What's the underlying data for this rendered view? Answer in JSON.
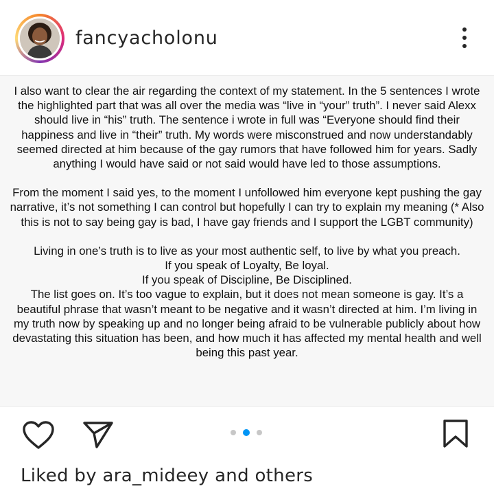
{
  "header": {
    "username": "fancyacholonu"
  },
  "post": {
    "paragraphs": [
      "I also want to clear the air regarding the context of my statement. In the 5 sentences I wrote the highlighted part that was all over the media was “live in “your” truth”. I never said Alexx should live in “his” truth. The sentence i wrote in full was “Everyone should find their happiness and live in “their” truth. My words were misconstrued and now understandably seemed directed at him because of the gay rumors that have followed him for years. Sadly anything I would have said or not said would have led to those assumptions.",
      "From the moment I said yes, to the moment I unfollowed him everyone kept pushing the gay narrative, it’s not something I can control but hopefully I can try to explain my meaning (* Also this is not to say being gay is bad, I have gay friends and I support the LGBT community)",
      "Living in one’s truth is to live as your most authentic self, to live by what you preach.",
      "If you speak of Loyalty, Be loyal.",
      "If you speak of Discipline, Be Disciplined.",
      "The list goes on. It’s too vague to explain, but it does not mean someone is gay. It’s a beautiful phrase that wasn’t meant to be negative and it wasn’t directed at him. I’m living in my truth now by speaking up and no longer being afraid to be vulnerable publicly about how devastating this situation has been, and how much it has affected my mental health and well being this past year."
    ],
    "carousel": {
      "total": 3,
      "active_index": 1
    }
  },
  "actions": {
    "like_icon": "heart-icon",
    "share_icon": "send-icon",
    "save_icon": "bookmark-icon"
  },
  "likes": {
    "prefix": "Liked by",
    "user": "ara_mideey",
    "connector": "and",
    "others": "others"
  },
  "colors": {
    "accent": "#0095f6",
    "text": "#262626",
    "post_bg": "#f7f7f7"
  }
}
